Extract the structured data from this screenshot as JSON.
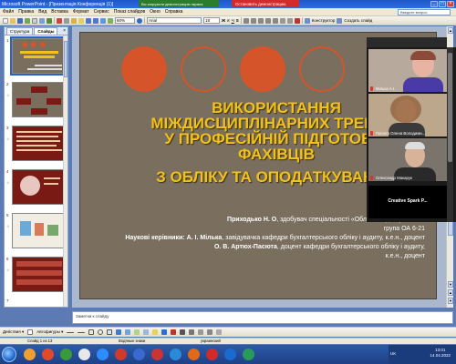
{
  "window": {
    "title": "Microsoft PowerPoint - [Презентація Конференція (1)]",
    "share_banner": "Вы загрузили демонстрацию экрана",
    "stop_demo": "Остановить демонстрацию"
  },
  "menu": {
    "items": [
      "Файл",
      "Правка",
      "Вид",
      "Вставка",
      "Формат",
      "Сервис",
      "Показ слайдов",
      "Окно",
      "Справка"
    ],
    "question_placeholder": "Введите вопрос"
  },
  "toolbar": {
    "zoom": "60%",
    "font_name": "Arial",
    "font_size": "18",
    "designer_label": "Конструктор",
    "create_slide_label": "Создать слайд"
  },
  "panel": {
    "tabs": [
      "Структура",
      "Слайды"
    ],
    "close_glyph": "×",
    "slide_numbers": [
      "1",
      "2",
      "3",
      "4",
      "5",
      "6",
      "7"
    ],
    "star_glyph": "☆"
  },
  "slide": {
    "title_lines": [
      "ВИКОРИСТАННЯ",
      "МІЖДИСЦИПЛІНАРНИХ ТРЕНДІВ",
      "У ПРОФЕСІЙНІЙ ПІДГОТОВЦІ",
      "ФАХІВЦІВ",
      "З ОБЛІКУ ТА ОПОДАТКУВАННЯ"
    ],
    "author_name": "Приходько Н. О",
    "author_rest": ", здобувач спеціальності «Облік і оподаткування»,",
    "author_group": "група ОА 6-21",
    "advisors_label": "Наукові керівники:",
    "advisor1_name": "А. І. Мілька",
    "advisor1_rest": ", завідувачка кафедри бухгалтерського обліку і аудиту, к.е.н., доцент",
    "advisor2_name": "О. В. Артюх-Пасюта",
    "advisor2_rest": ", доцент кафедри бухгалтерського обліку і аудиту,",
    "advisor2_degree": "к.е.н., доцент"
  },
  "notes": {
    "placeholder": "Заметки к слайду"
  },
  "drawbar": {
    "actions_label": "Действия ▾",
    "autoshapes_label": "Автофигуры ▾"
  },
  "status": {
    "slide_counter": "Слайд 1 из 13",
    "design_name": "Водяные знаки",
    "language": "украинский"
  },
  "video": {
    "tiles": [
      {
        "name": "Мілька А.І."
      },
      {
        "name": "Пасюта Олена Володими..."
      },
      {
        "name": "Олександр Макарук"
      }
    ],
    "blank_tile_name": "Creative Spark P..."
  },
  "taskbar": {
    "lang": "UK",
    "time": "13:01",
    "date": "14.04.2022"
  }
}
